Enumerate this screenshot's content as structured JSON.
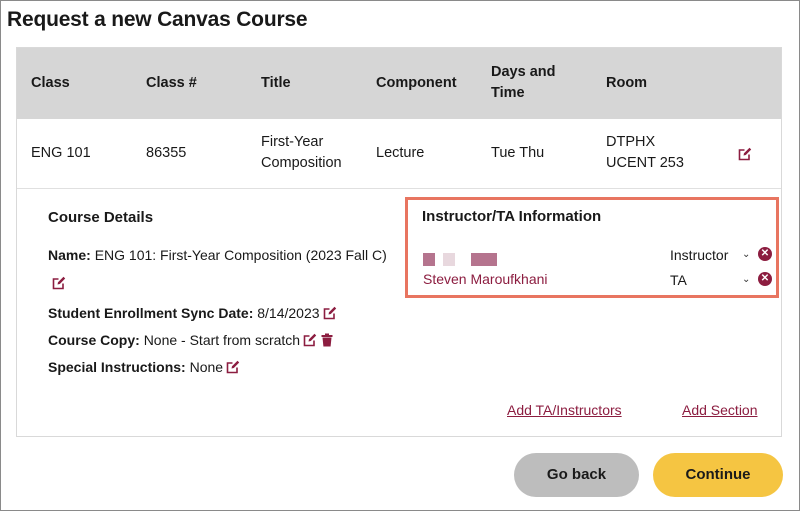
{
  "page": {
    "title": "Request a new Canvas Course"
  },
  "table": {
    "headers": {
      "class": "Class",
      "class_num": "Class #",
      "title": "Title",
      "component": "Component",
      "days_line1": "Days and",
      "days_line2": "Time",
      "room": "Room"
    },
    "row": {
      "class": "ENG 101",
      "class_num": "86355",
      "title_line1": "First-Year",
      "title_line2": "Composition",
      "component": "Lecture",
      "days": "Tue Thu",
      "room_line1": "DTPHX",
      "room_line2": "UCENT 253"
    }
  },
  "course_details": {
    "title": "Course Details",
    "name_label": "Name:",
    "name_value": "ENG 101: First-Year Composition (2023 Fall C)",
    "sync_label": "Student Enrollment Sync Date:",
    "sync_value": "8/14/2023",
    "copy_label": "Course Copy:",
    "copy_value": "None - Start from scratch",
    "special_label": "Special Instructions:",
    "special_value": "None"
  },
  "instructor_info": {
    "title": "Instructor/TA Information",
    "rows": [
      {
        "name": "",
        "role": "Instructor"
      },
      {
        "name": "Steven Maroufkhani",
        "role": "TA"
      }
    ]
  },
  "links": {
    "add_ta": "Add TA/Instructors",
    "add_section": "Add Section"
  },
  "buttons": {
    "back": "Go back",
    "continue": "Continue"
  },
  "colors": {
    "accent": "#8c1d40",
    "header_bg": "#d6d6d6",
    "highlight_border": "#e87560",
    "continue_bg": "#f5c542",
    "back_bg": "#bdbdbd"
  },
  "icons": {
    "edit": "edit-icon",
    "trash": "trash-icon",
    "remove": "remove-icon",
    "chevron": "chevron-down-icon"
  }
}
